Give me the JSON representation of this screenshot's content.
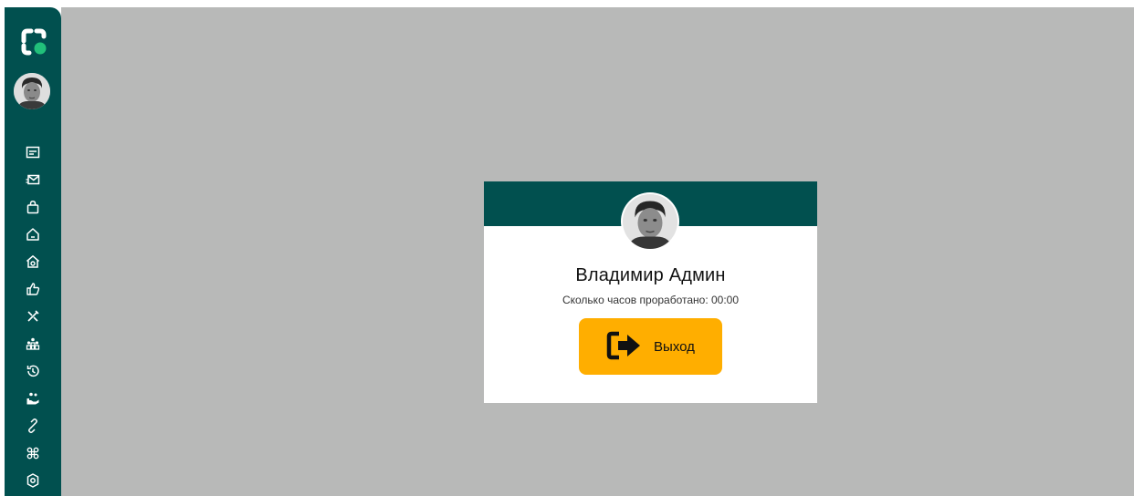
{
  "colors": {
    "sidebar": "#01504f",
    "accent": "#ffae00",
    "backdrop": "#b8b9b8",
    "logo_dot": "#21c07a"
  },
  "sidebar": {
    "logo_icon": "app-logo",
    "avatar_icon": "user-avatar",
    "items": [
      {
        "icon": "id-card-icon"
      },
      {
        "icon": "mail-send-icon"
      },
      {
        "icon": "shopping-bag-icon"
      },
      {
        "icon": "home-icon"
      },
      {
        "icon": "home-settings-icon"
      },
      {
        "icon": "thumbs-up-icon"
      },
      {
        "icon": "tools-icon"
      },
      {
        "icon": "team-icon"
      },
      {
        "icon": "history-icon"
      },
      {
        "icon": "hand-coins-icon"
      },
      {
        "icon": "link-icon"
      },
      {
        "icon": "command-icon"
      },
      {
        "icon": "settings-icon"
      }
    ]
  },
  "profile_card": {
    "name": "Владимир Админ",
    "hours_worked": "Сколько часов проработано: 00:00",
    "logout_label": "Выход",
    "logout_icon": "logout-arrow-icon"
  }
}
